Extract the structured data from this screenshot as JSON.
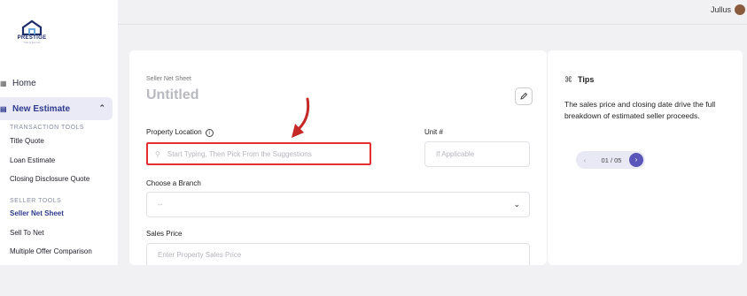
{
  "brand": {
    "name": "PRESTIGE",
    "tagline": "Title & Escrow"
  },
  "topbar": {
    "user_name": "Jullus"
  },
  "sidebar": {
    "home": "Home",
    "new_estimate": "New Estimate",
    "transaction_tools_label": "TRANSACTION TOOLS",
    "transaction_tools": [
      "Title Quote",
      "Loan Estimate",
      "Closing Disclosure Quote"
    ],
    "seller_tools_label": "SELLER TOOLS",
    "seller_tools": [
      "Seller Net Sheet",
      "Sell To Net",
      "Multiple Offer Comparison"
    ]
  },
  "form": {
    "subtitle": "Seller Net Sheet",
    "title": "Untitled",
    "property_location_label": "Property Location",
    "property_location_placeholder": "Start Typing, Then Pick From the Suggestions",
    "unit_label": "Unit #",
    "unit_placeholder": "If Applicable",
    "branch_label": "Choose a Branch",
    "branch_value": "--",
    "sales_price_label": "Sales Price",
    "sales_price_placeholder": "Enter Property Sales Price"
  },
  "tips": {
    "title": "Tips",
    "text": "The sales price and closing date drive the full breakdown of estimated seller proceeds.",
    "pager": "01 / 05"
  },
  "colors": {
    "accent": "#2f3a8f",
    "highlight": "#e0312f",
    "pager_button": "#5a55b8"
  }
}
